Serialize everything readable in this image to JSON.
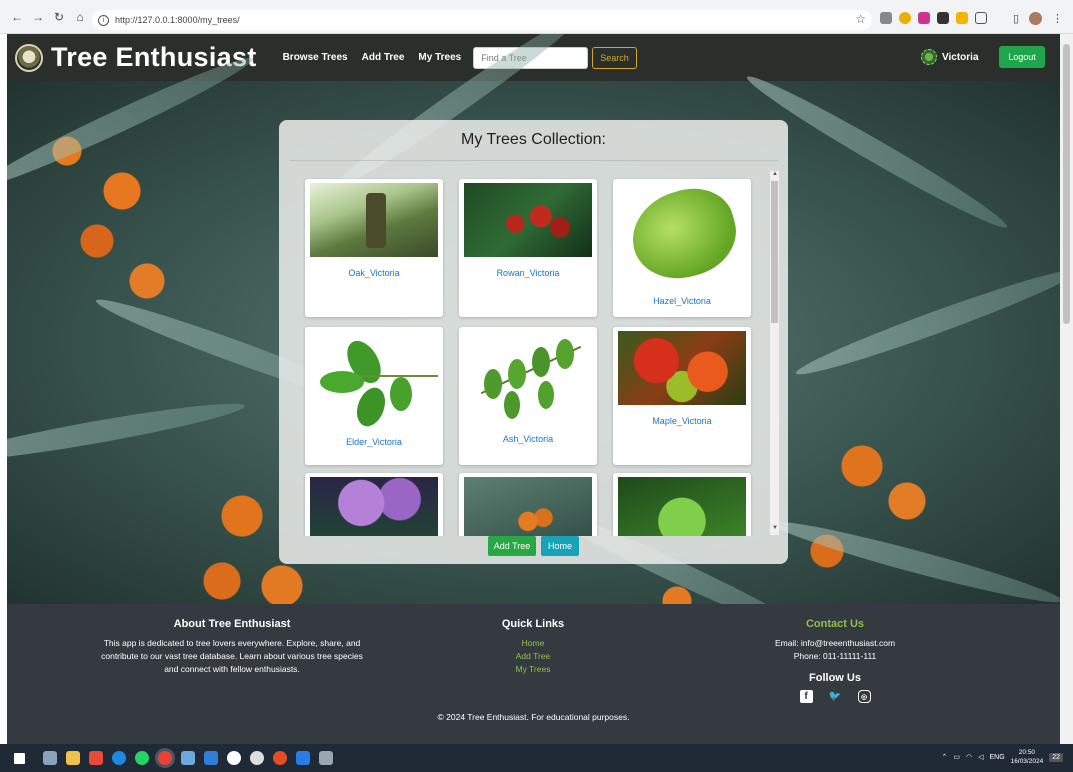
{
  "browser": {
    "url": "http://127.0.0.1:8000/my_trees/"
  },
  "navbar": {
    "brand": "Tree Enthusiast",
    "links": [
      "Browse Trees",
      "Add Tree",
      "My Trees"
    ],
    "search_placeholder": "Find a Tree",
    "search_label": "Search",
    "username": "Victoria",
    "logout_label": "Logout"
  },
  "collection": {
    "title": "My Trees Collection:",
    "trees": [
      {
        "name": "Oak_Victoria",
        "image": "mossy-oak-forest"
      },
      {
        "name": "Rowan_Victoria",
        "image": "rowan-berries"
      },
      {
        "name": "Hazel_Victoria",
        "image": "hazel-leaf"
      },
      {
        "name": "Elder_Victoria",
        "image": "elder-leaf"
      },
      {
        "name": "Ash_Victoria",
        "image": "ash-leaf"
      },
      {
        "name": "Maple_Victoria",
        "image": "maple-leaves"
      },
      {
        "name": "",
        "image": "lilac-flowers"
      },
      {
        "name": "",
        "image": "sea-buckthorn"
      },
      {
        "name": "",
        "image": "conifer-needles"
      }
    ],
    "add_label": "Add Tree",
    "home_label": "Home"
  },
  "footer": {
    "about_title": "About Tree Enthusiast",
    "about_text_1": "This app is dedicated to tree lovers everywhere. Explore, share, and",
    "about_text_2": "contribute to our vast tree database. Learn about various tree species",
    "about_text_3": "and connect with fellow enthusiasts.",
    "links_title": "Quick Links",
    "links": [
      "Home",
      "Add Tree",
      "My Trees"
    ],
    "contact_title": "Contact Us",
    "email": "Email: info@treeenthusiast.com",
    "phone": "Phone: 011-11111-111",
    "follow_title": "Follow Us",
    "copyright": "© 2024 Tree Enthusiast. For educational purposes."
  },
  "taskbar": {
    "lang": "ENG",
    "time": "20:50",
    "date": "16/03/2024",
    "notifications": "22"
  },
  "colors": {
    "navbar_bg": "#2b2f2c",
    "footer_bg": "#343a40",
    "accent_green": "#8bc34a",
    "link_blue": "#1a73c9"
  }
}
